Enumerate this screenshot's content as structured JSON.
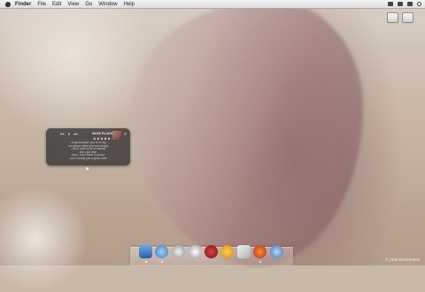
{
  "menubar": {
    "items": [
      "Finder",
      "File",
      "Edit",
      "View",
      "Go",
      "Window",
      "Help"
    ]
  },
  "player": {
    "controls": [
      "⏮",
      "⏸",
      "⏭"
    ],
    "now_playing": "NOW PLAYING",
    "stars": "★★★★★",
    "close": "×",
    "lyrics": [
      "I'm gonna take you on a trip",
      "I'm gonna make you feel alright",
      "I don't have a lot of money",
      "But I got time",
      "Hey, I don't have a penny",
      "But I'll show you a good time"
    ]
  },
  "dock": {
    "icons": [
      "finder-icon",
      "safari-icon",
      "system-icon",
      "robot-icon",
      "media-icon",
      "smiley-icon",
      "quill-icon",
      "firefox-icon",
      "globe-icon"
    ]
  },
  "watermark": "© julie-kosemarie"
}
